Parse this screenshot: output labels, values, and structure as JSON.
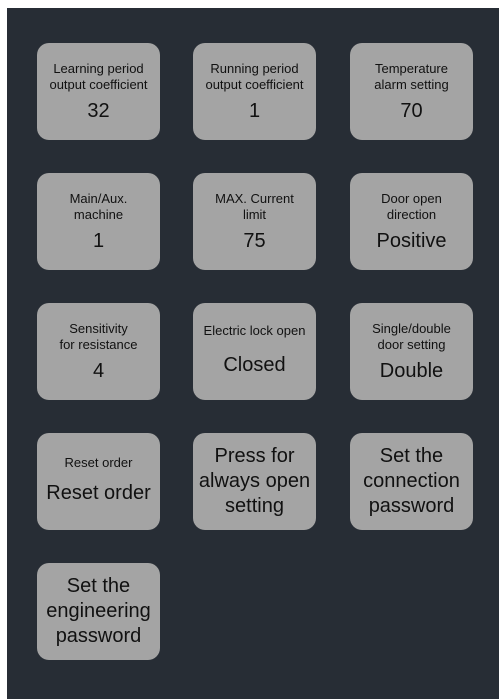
{
  "tiles": {
    "learning_coef": {
      "label": "Learning period\noutput coefficient",
      "value": "32"
    },
    "running_coef": {
      "label": "Running period\noutput coefficient",
      "value": "1"
    },
    "temp_alarm": {
      "label": "Temperature\nalarm setting",
      "value": "70"
    },
    "main_aux": {
      "label": "Main/Aux.\nmachine",
      "value": "1"
    },
    "max_current": {
      "label": "MAX. Current\nlimit",
      "value": "75"
    },
    "door_direction": {
      "label": "Door open\ndirection",
      "value": "Positive"
    },
    "sensitivity": {
      "label": "Sensitivity\nfor resistance",
      "value": "4"
    },
    "electric_lock": {
      "label": "Electric lock open",
      "value": "Closed"
    },
    "single_double": {
      "label": "Single/double\ndoor setting",
      "value": "Double"
    },
    "reset_order": {
      "label": "Reset order",
      "value": "Reset order"
    },
    "always_open": {
      "text": "Press for\nalways open\nsetting"
    },
    "connection_password": {
      "text": "Set the\nconnection\npassword"
    },
    "engineering_password": {
      "text": "Set the\nengineering\npassword"
    }
  }
}
